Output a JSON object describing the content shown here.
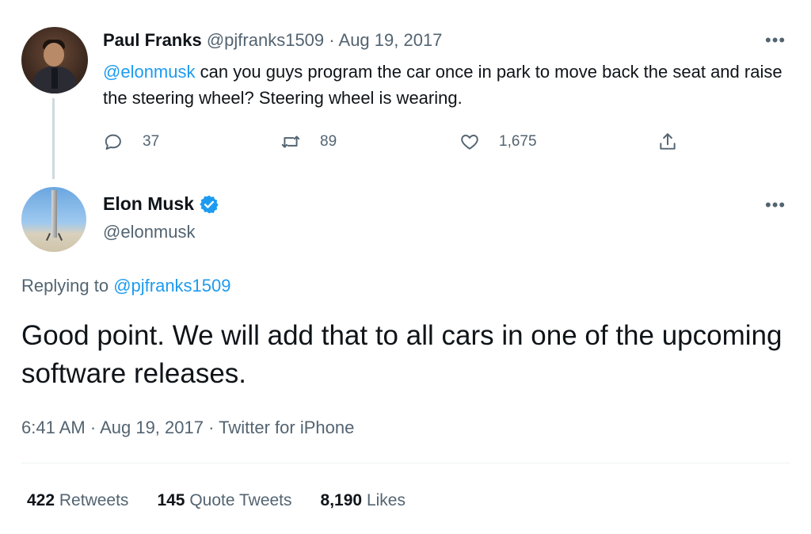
{
  "reply_to_tweet": {
    "author_name": "Paul Franks",
    "author_handle": "@pjfranks1509",
    "separator": "·",
    "date": "Aug 19, 2017",
    "mention": "@elonmusk",
    "text": " can you guys program the car once in park to move back the seat and raise the steering wheel? Steering wheel is wearing.",
    "more_label": "•••",
    "actions": {
      "reply_count": "37",
      "retweet_count": "89",
      "like_count": "1,675"
    }
  },
  "main_tweet": {
    "author_name": "Elon Musk",
    "author_handle": "@elonmusk",
    "more_label": "•••",
    "replying_prefix": "Replying to ",
    "replying_handle": "@pjfranks1509",
    "text": "Good point. We will add that to all cars in one of the upcoming software releases.",
    "time": "6:41 AM",
    "date": "Aug 19, 2017",
    "source": "Twitter for iPhone",
    "separator": "·",
    "stats": {
      "retweets_count": "422",
      "retweets_label": "Retweets",
      "quote_count": "145",
      "quote_label": "Quote Tweets",
      "likes_count": "8,190",
      "likes_label": "Likes"
    }
  },
  "colors": {
    "accent": "#1d9bf0",
    "text": "#0f1419",
    "muted": "#536471",
    "divider": "#eff3f4"
  },
  "icons": {
    "reply": "reply-icon",
    "retweet": "retweet-icon",
    "like": "heart-icon",
    "share": "share-icon",
    "verified": "verified-badge-icon"
  }
}
